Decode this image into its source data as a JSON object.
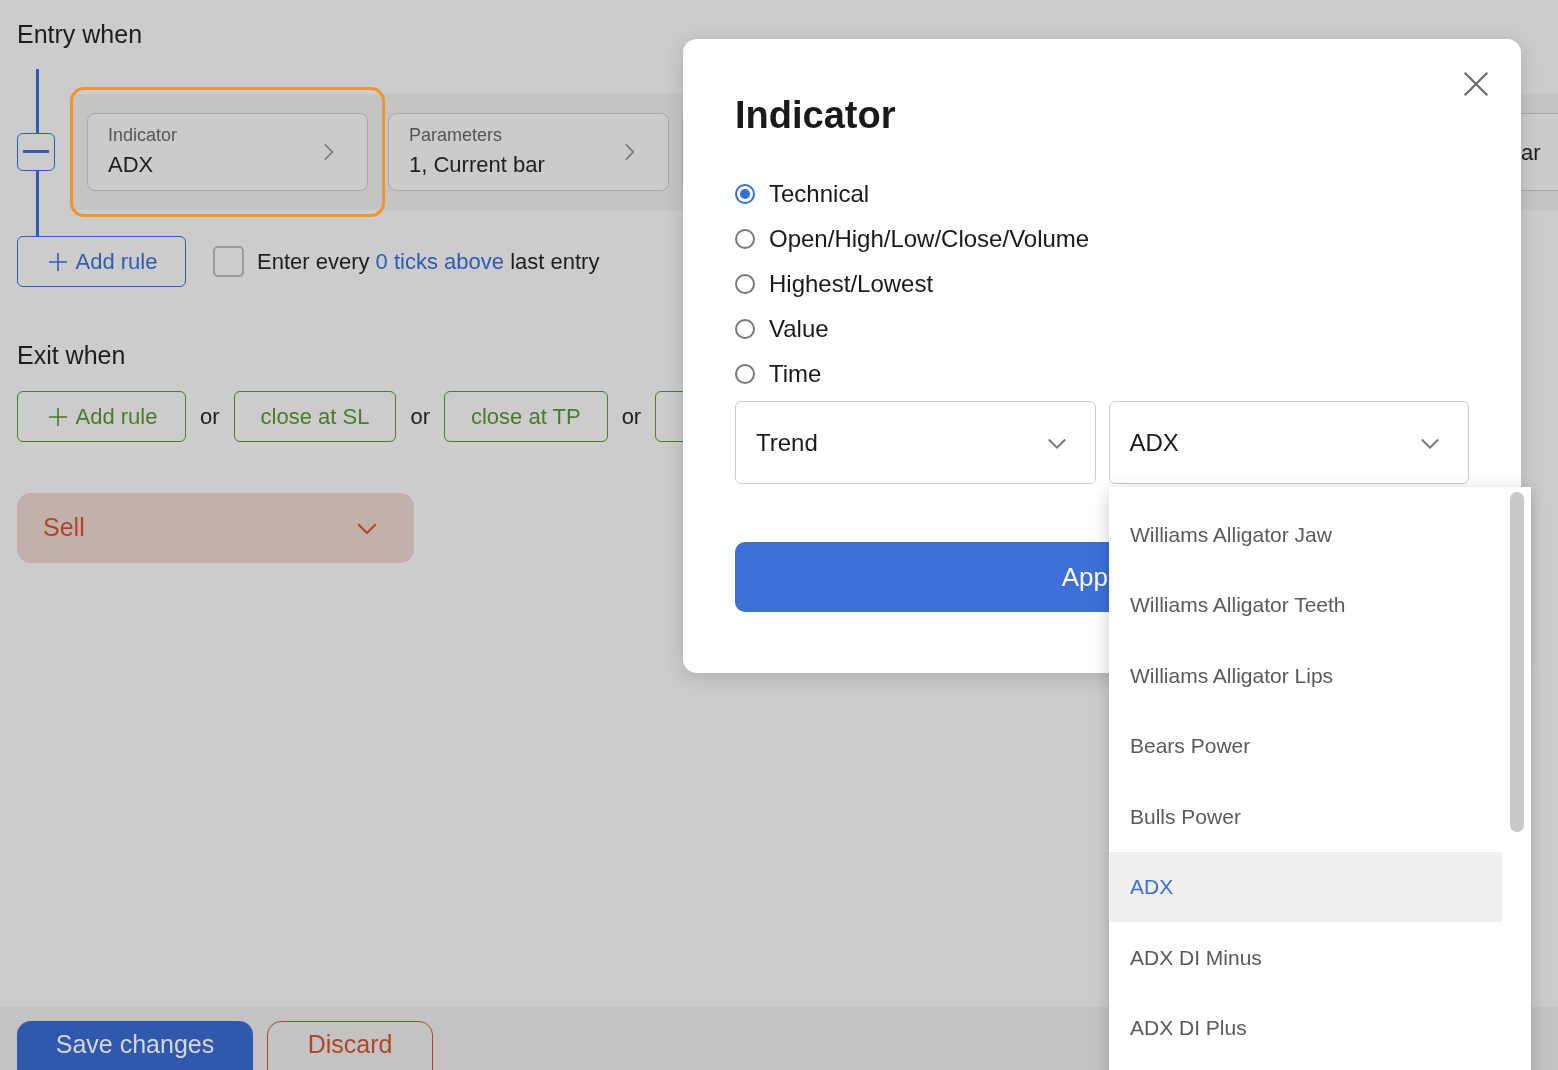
{
  "entry": {
    "title": "Entry when",
    "rule": {
      "cards": [
        {
          "label": "Indicator",
          "value": "ADX",
          "highlighted": true
        },
        {
          "label": "Parameters",
          "value": "1, Current bar",
          "highlighted": false
        }
      ],
      "tail_text": "ar"
    },
    "add_rule": "Add rule",
    "repeat": {
      "checked": false,
      "text": "Enter every **0 ticks above** last entry"
    }
  },
  "exit": {
    "title": "Exit when",
    "add_rule": "Add rule",
    "separators": [
      "or",
      "or",
      "or"
    ],
    "buttons": [
      "close at SL",
      "close at TP"
    ]
  },
  "side": {
    "value": "Sell"
  },
  "footer": {
    "save": "Save changes",
    "discard": "Discard"
  },
  "dialog": {
    "title": "Indicator",
    "options": [
      {
        "label": "Technical",
        "selected": true
      },
      {
        "label": "Open/High/Low/Close/Volume",
        "selected": false
      },
      {
        "label": "Highest/Lowest",
        "selected": false
      },
      {
        "label": "Value",
        "selected": false
      },
      {
        "label": "Time",
        "selected": false
      }
    ],
    "category": "Trend",
    "indicator": "ADX",
    "apply": "App",
    "list": [
      {
        "label": "Williams Alligator Jaw",
        "selected": false
      },
      {
        "label": "Williams Alligator Teeth",
        "selected": false
      },
      {
        "label": "Williams Alligator Lips",
        "selected": false
      },
      {
        "label": "Bears Power",
        "selected": false
      },
      {
        "label": "Bulls Power",
        "selected": false
      },
      {
        "label": "ADX",
        "selected": true
      },
      {
        "label": "ADX DI Minus",
        "selected": false
      },
      {
        "label": "ADX DI Plus",
        "selected": false
      }
    ]
  }
}
